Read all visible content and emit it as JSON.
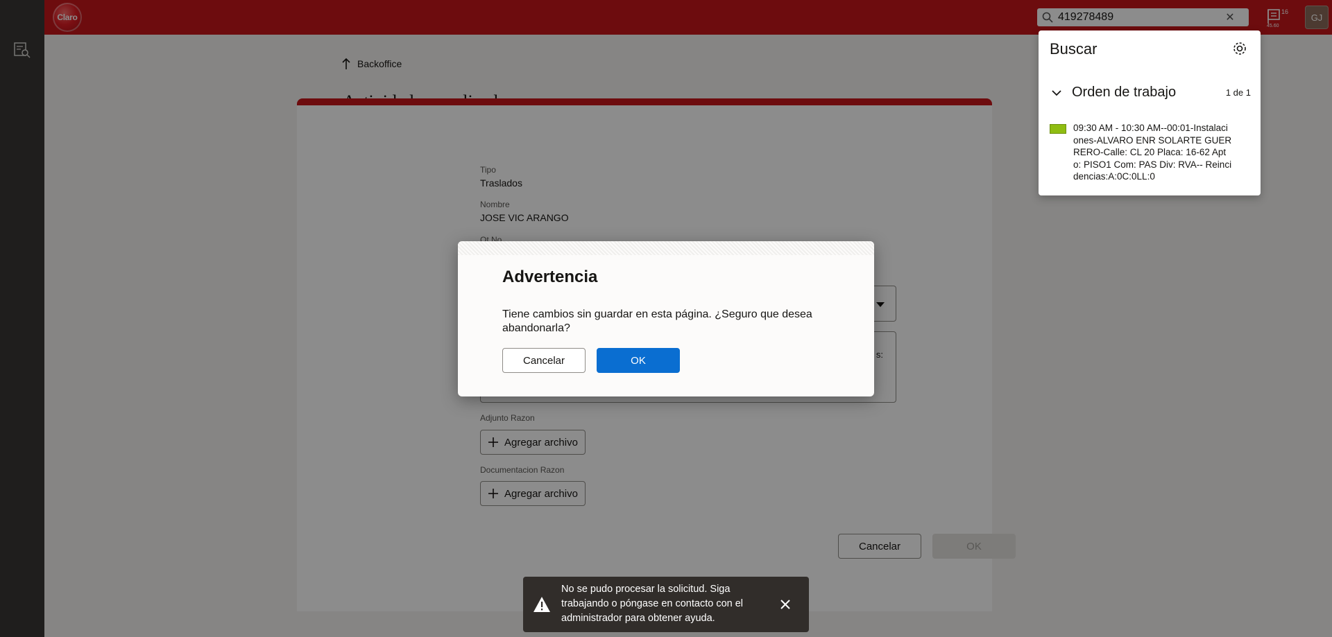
{
  "header": {
    "logo_text": "Claro",
    "search_value": "419278489",
    "notification_count": "16",
    "notification_sub": "45.60",
    "avatar_initials": "GJ"
  },
  "breadcrumb": {
    "label": "Backoffice"
  },
  "page": {
    "title": "Actividad no realizada"
  },
  "form": {
    "tipo_label": "Tipo",
    "tipo_value": "Traslados",
    "nombre_label": "Nombre",
    "nombre_value": "JOSE VIC ARANGO",
    "ot_label": "Ot No",
    "textarea_tail": "s:",
    "adjunto_label": "Adjunto Razon",
    "documentacion_label": "Documentacion Razon",
    "add_file_label": "Agregar archivo",
    "cancel_label": "Cancelar",
    "ok_label": "OK"
  },
  "search_panel": {
    "title": "Buscar",
    "group_title": "Orden de trabajo",
    "group_count": "1 de 1",
    "result_text": "09:30 AM - 10:30 AM--00:01-Instalaciones-ALVARO ENR SOLARTE GUERRERO-Calle: CL 20 Placa: 16-62 Apto: PISO1 Com: PAS Div: RVA-- Reincidencias:A:0C:0LL:0",
    "result_color": "#8fbd12"
  },
  "dialog": {
    "title": "Advertencia",
    "message": "Tiene cambios sin guardar en esta página. ¿Seguro que desea abandonarla?",
    "cancel_label": "Cancelar",
    "ok_label": "OK"
  },
  "toast": {
    "message": "No se pudo procesar la solicitud. Siga trabajando o póngase en contacto con el administrador para obtener ayuda."
  },
  "colors": {
    "brand": "#c7161b",
    "primary": "#0a6ed1",
    "overlay": "rgba(0,0,0,0.45)"
  }
}
